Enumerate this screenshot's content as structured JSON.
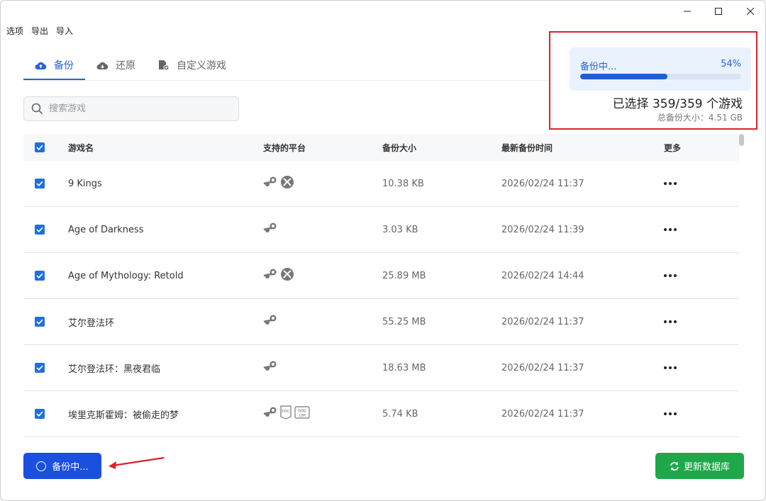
{
  "menu": [
    "选项",
    "导出",
    "导入"
  ],
  "tabs": [
    {
      "label": "备份",
      "icon": "cloud-upload-icon",
      "active": true
    },
    {
      "label": "还原",
      "icon": "cloud-download-icon",
      "active": false
    },
    {
      "label": "自定义游戏",
      "icon": "custom-file-icon",
      "active": false
    }
  ],
  "search": {
    "placeholder": "搜索游戏"
  },
  "progress": {
    "label": "备份中...",
    "percent_text": "54%",
    "percent": 54,
    "selected_text": "已选择 359/359 个游戏",
    "total_size_text": "总备份大小：4.51 GB"
  },
  "table": {
    "headers": {
      "name": "游戏名",
      "platform": "支持的平台",
      "size": "备份大小",
      "time": "最新备份时间",
      "more": "更多"
    },
    "rows": [
      {
        "name": "9 Kings",
        "platforms": [
          "steam",
          "xbox"
        ],
        "size": "10.38 KB",
        "time": "2026/02/24 11:37"
      },
      {
        "name": "Age of Darkness",
        "platforms": [
          "steam"
        ],
        "size": "3.03 KB",
        "time": "2026/02/24 11:39"
      },
      {
        "name": "Age of Mythology: Retold",
        "platforms": [
          "steam",
          "xbox"
        ],
        "size": "25.89 MB",
        "time": "2026/02/24 14:44"
      },
      {
        "name": "艾尔登法环",
        "platforms": [
          "steam"
        ],
        "size": "55.25 MB",
        "time": "2026/02/24 11:37"
      },
      {
        "name": "艾尔登法环：黑夜君临",
        "platforms": [
          "steam"
        ],
        "size": "18.63 MB",
        "time": "2026/02/24 11:37"
      },
      {
        "name": "埃里克斯霍姆：被偷走的梦",
        "platforms": [
          "steam",
          "epic",
          "gog"
        ],
        "size": "5.74 KB",
        "time": "2026/02/24 11:37"
      }
    ]
  },
  "buttons": {
    "backup": "备份中...",
    "update_db": "更新数据库"
  },
  "colors": {
    "accent": "#2962d9",
    "primary_button": "#1a4fe0",
    "success_button": "#1ea84a",
    "highlight": "#d9232d"
  }
}
